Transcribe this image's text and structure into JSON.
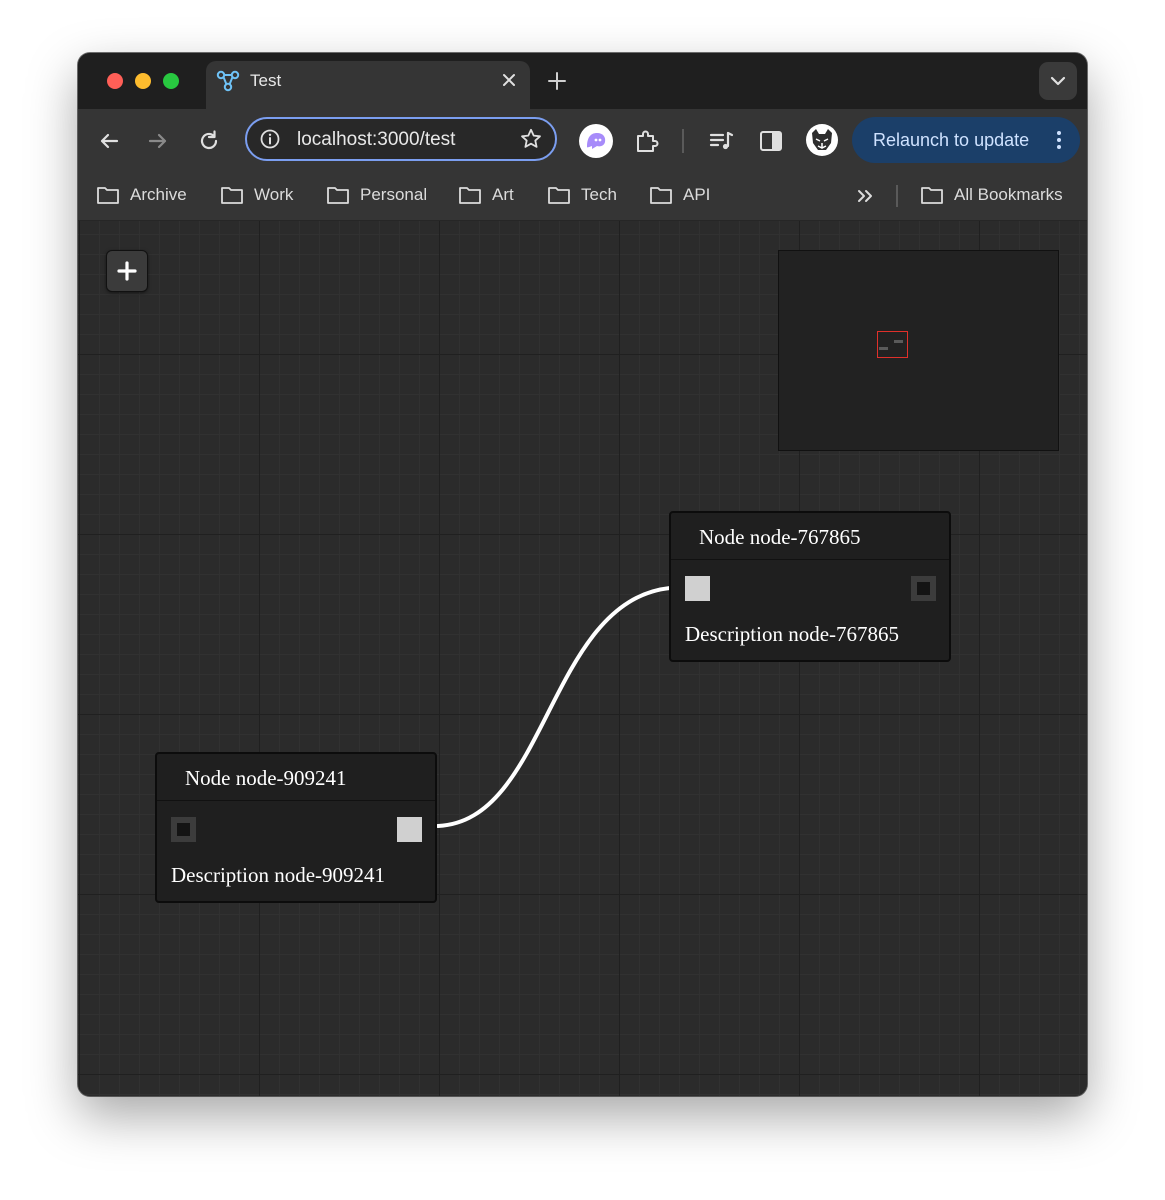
{
  "browser": {
    "tab": {
      "title": "Test",
      "favicon": "flow-graph-icon"
    },
    "address_bar": {
      "url": "localhost:3000/test"
    },
    "relaunch_label": "Relaunch to update"
  },
  "bookmarks": {
    "items": [
      {
        "label": "Archive"
      },
      {
        "label": "Work"
      },
      {
        "label": "Personal"
      },
      {
        "label": "Art"
      },
      {
        "label": "Tech"
      },
      {
        "label": "API"
      }
    ],
    "all_label": "All Bookmarks"
  },
  "canvas": {
    "nodes": [
      {
        "id": "node-767865",
        "title": "Node node-767865",
        "description": "Description node-767865"
      },
      {
        "id": "node-909241",
        "title": "Node node-909241",
        "description": "Description node-909241"
      }
    ],
    "edge": {
      "from": "node-909241",
      "to": "node-767865"
    }
  },
  "colors": {
    "canvas_bg": "#2b2b2b",
    "node_bg": "#1f1f1f",
    "edge": "#ffffff",
    "minimap_viewport": "#e0302a",
    "omnibox_focus": "#7b9ef0",
    "relaunch_bg": "#1b3f69"
  }
}
